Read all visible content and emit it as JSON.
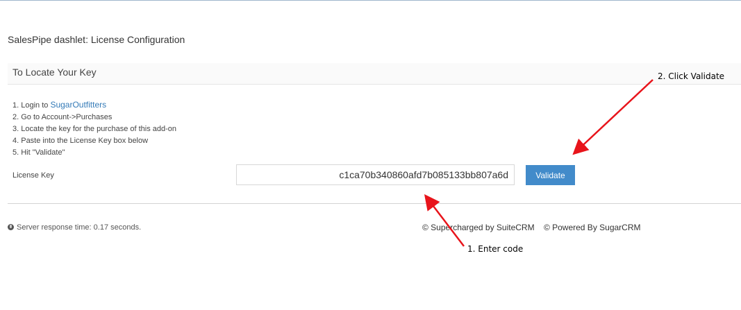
{
  "page": {
    "title": "SalesPipe dashlet: License Configuration"
  },
  "panel": {
    "heading": "To Locate Your Key",
    "steps": {
      "s1_prefix": "1. Login to ",
      "s1_link": "SugarOutfitters",
      "s2": "2. Go to Account->Purchases",
      "s3": "3. Locate the key for the purchase of this add-on",
      "s4": "4. Paste into the License Key box below",
      "s5": "5. Hit \"Validate\""
    },
    "license_label": "License Key",
    "license_value": "c1ca70b340860afd7b085133bb807a6d",
    "validate_label": "Validate"
  },
  "footer": {
    "server_response": "Server response time: 0.17 seconds.",
    "supercharged": "© Supercharged by SuiteCRM",
    "powered": "© Powered By SugarCRM"
  },
  "annotations": {
    "click_validate": "2. Click Validate",
    "enter_code": "1. Enter code",
    "arrow_color": "#e8141b"
  },
  "icons": {
    "globe": "globe-icon"
  }
}
